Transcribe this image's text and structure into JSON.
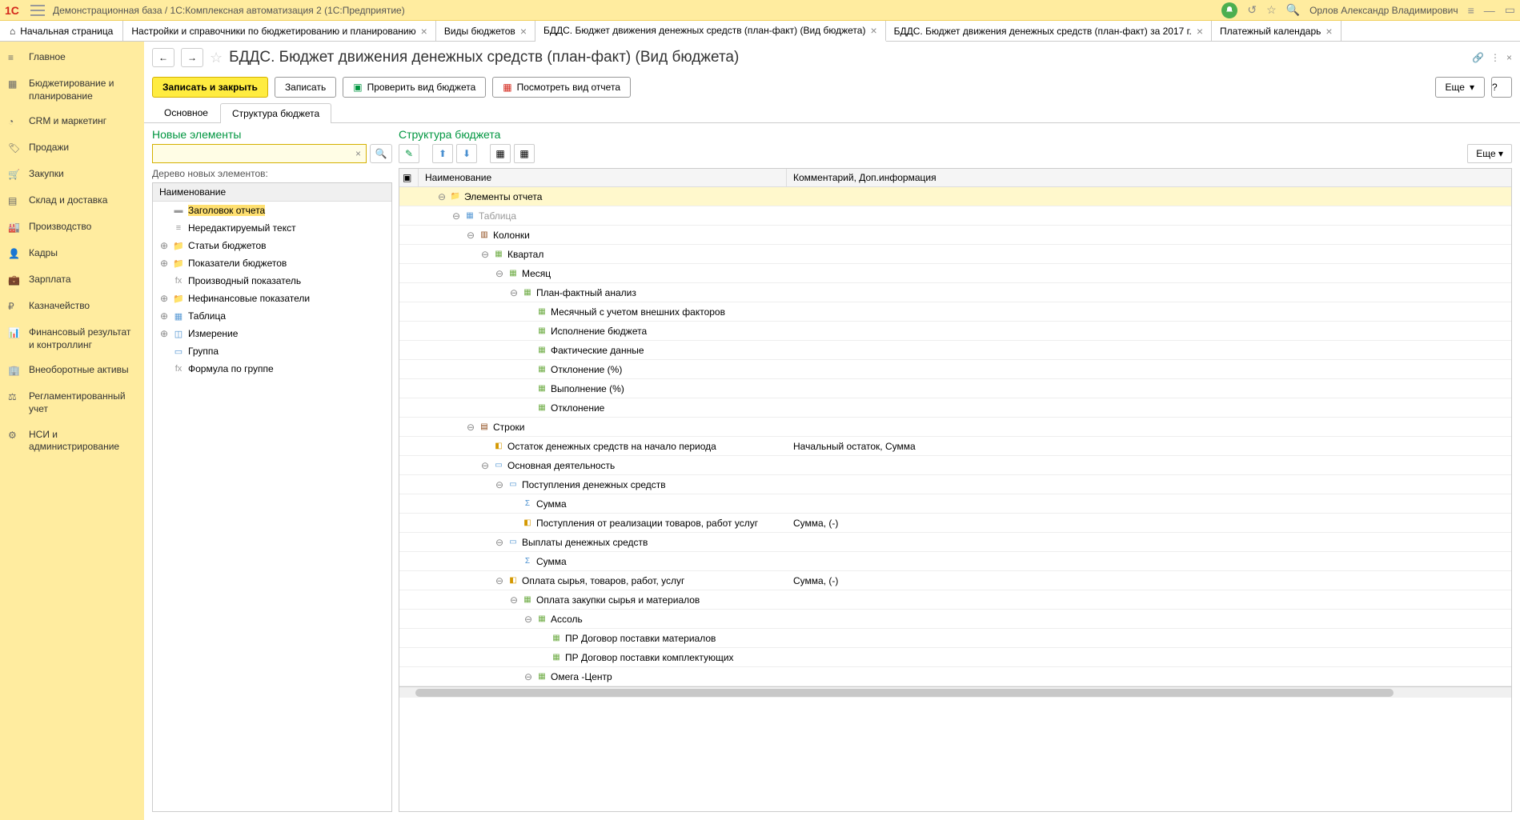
{
  "top": {
    "title": "Демонстрационная база / 1С:Комплексная автоматизация 2  (1С:Предприятие)",
    "user": "Орлов Александр Владимирович"
  },
  "tabs": {
    "home": "Начальная страница",
    "items": [
      {
        "label": "Настройки и справочники по бюджетированию и планированию"
      },
      {
        "label": "Виды  бюджетов"
      },
      {
        "label": "БДДС. Бюджет движения денежных средств (план-факт) (Вид бюджета)",
        "active": true
      },
      {
        "label": "БДДС. Бюджет движения денежных средств (план-факт)  за 2017 г."
      },
      {
        "label": "Платежный календарь"
      }
    ]
  },
  "sidebar": [
    {
      "label": "Главное"
    },
    {
      "label": "Бюджетирование и планирование"
    },
    {
      "label": "CRM и маркетинг"
    },
    {
      "label": "Продажи"
    },
    {
      "label": "Закупки"
    },
    {
      "label": "Склад и доставка"
    },
    {
      "label": "Производство"
    },
    {
      "label": "Кадры"
    },
    {
      "label": "Зарплата"
    },
    {
      "label": "Казначейство"
    },
    {
      "label": "Финансовый результат и контроллинг"
    },
    {
      "label": "Внеоборотные активы"
    },
    {
      "label": "Регламентированный учет"
    },
    {
      "label": "НСИ и администрирование"
    }
  ],
  "page": {
    "title": "БДДС. Бюджет движения денежных средств (план-факт) (Вид бюджета)"
  },
  "commands": {
    "save_close": "Записать и закрыть",
    "save": "Записать",
    "check": "Проверить вид бюджета",
    "preview": "Посмотреть вид отчета",
    "more": "Еще",
    "help": "?"
  },
  "subtabs": {
    "main": "Основное",
    "structure": "Структура бюджета"
  },
  "left_panel": {
    "title": "Новые элементы",
    "tree_label": "Дерево новых элементов:",
    "header": "Наименование",
    "items": [
      {
        "label": "Заголовок отчета",
        "icon": "head",
        "selected": true
      },
      {
        "label": "Нередактируемый текст",
        "icon": "text"
      },
      {
        "label": "Статьи бюджетов",
        "icon": "folder",
        "expandable": true
      },
      {
        "label": "Показатели бюджетов",
        "icon": "folder",
        "expandable": true
      },
      {
        "label": "Производный показатель",
        "icon": "fx"
      },
      {
        "label": "Нефинансовые показатели",
        "icon": "folder",
        "expandable": true
      },
      {
        "label": "Таблица",
        "icon": "table",
        "expandable": true
      },
      {
        "label": "Измерение",
        "icon": "dim",
        "expandable": true
      },
      {
        "label": "Группа",
        "icon": "group"
      },
      {
        "label": "Формула по группе",
        "icon": "fx"
      }
    ]
  },
  "right_panel": {
    "title": "Структура бюджета",
    "more": "Еще",
    "col_name": "Наименование",
    "col_comment": "Комментарий, Доп.информация",
    "rows": [
      {
        "indent": 0,
        "exp": "-",
        "icon": "folder",
        "label": "Элементы отчета",
        "selected": true
      },
      {
        "indent": 1,
        "exp": "-",
        "icon": "table",
        "label": "Таблица",
        "dim": true
      },
      {
        "indent": 2,
        "exp": "-",
        "icon": "cols",
        "label": "Колонки"
      },
      {
        "indent": 3,
        "exp": "-",
        "icon": "grid",
        "label": "Квартал"
      },
      {
        "indent": 4,
        "exp": "-",
        "icon": "grid",
        "label": "Месяц"
      },
      {
        "indent": 5,
        "exp": "-",
        "icon": "grid",
        "label": "План-фактный анализ"
      },
      {
        "indent": 6,
        "exp": "",
        "icon": "grid",
        "label": "Месячный с учетом внешних факторов"
      },
      {
        "indent": 6,
        "exp": "",
        "icon": "grid",
        "label": "Исполнение бюджета"
      },
      {
        "indent": 6,
        "exp": "",
        "icon": "grid",
        "label": "Фактические данные"
      },
      {
        "indent": 6,
        "exp": "",
        "icon": "grid",
        "label": "Отклонение (%)"
      },
      {
        "indent": 6,
        "exp": "",
        "icon": "grid",
        "label": "Выполнение (%)"
      },
      {
        "indent": 6,
        "exp": "",
        "icon": "grid",
        "label": "Отклонение"
      },
      {
        "indent": 2,
        "exp": "-",
        "icon": "rows",
        "label": "Строки"
      },
      {
        "indent": 3,
        "exp": "",
        "icon": "cube",
        "label": "Остаток денежных средств на начало периода",
        "comment": "Начальный остаток, Сумма"
      },
      {
        "indent": 3,
        "exp": "-",
        "icon": "group",
        "label": "Основная деятельность"
      },
      {
        "indent": 4,
        "exp": "-",
        "icon": "group",
        "label": "Поступления денежных средств"
      },
      {
        "indent": 5,
        "exp": "",
        "icon": "sum",
        "label": "Сумма"
      },
      {
        "indent": 5,
        "exp": "",
        "icon": "cube",
        "label": "Поступления от реализации товаров, работ услуг",
        "comment": "Сумма, (-)"
      },
      {
        "indent": 4,
        "exp": "-",
        "icon": "group",
        "label": "Выплаты денежных средств"
      },
      {
        "indent": 5,
        "exp": "",
        "icon": "sum",
        "label": "Сумма"
      },
      {
        "indent": 4,
        "exp": "-",
        "icon": "cube",
        "label": "Оплата сырья, товаров, работ, услуг",
        "comment": "Сумма, (-)"
      },
      {
        "indent": 5,
        "exp": "-",
        "icon": "grid",
        "label": "Оплата закупки сырья и материалов"
      },
      {
        "indent": 6,
        "exp": "-",
        "icon": "grid",
        "label": "Ассоль"
      },
      {
        "indent": 7,
        "exp": "",
        "icon": "grid",
        "label": "ПР Договор поставки материалов"
      },
      {
        "indent": 7,
        "exp": "",
        "icon": "grid",
        "label": "ПР Договор поставки комплектующих"
      },
      {
        "indent": 6,
        "exp": "-",
        "icon": "grid",
        "label": "Омега -Центр"
      }
    ]
  }
}
